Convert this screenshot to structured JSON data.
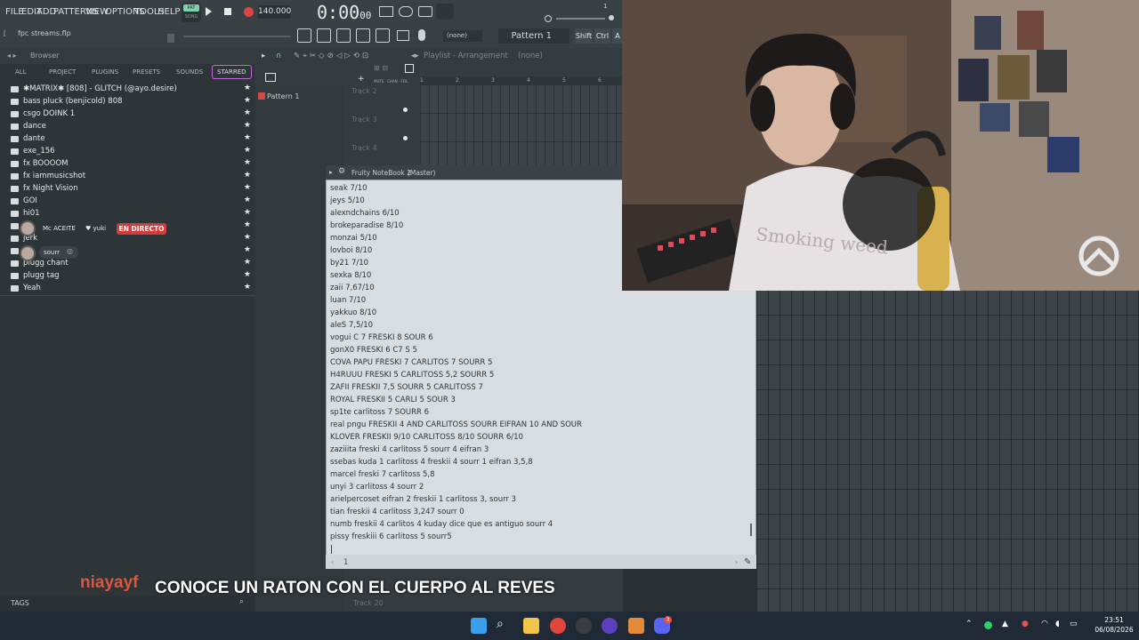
{
  "menubar": {
    "items": [
      "FILE",
      "EDIT",
      "ADD",
      "PATTERNS",
      "VIEW",
      "OPTIONS",
      "TOOLS",
      "HELP"
    ],
    "tempo": "140.000",
    "time": "0:00",
    "time_small": "00",
    "pat_label": "PAT",
    "song_label": "SONG"
  },
  "toolbar": {
    "project_file": "fpc streams.flp",
    "pattern_select": "Pattern 1",
    "none_select": "(none)",
    "shift_label": "Shift",
    "ctrl_label": "Ctrl",
    "alt_label": "A"
  },
  "browser": {
    "title": "Browser",
    "tabs": [
      "ALL",
      "PROJECT",
      "PLUGINS",
      "PRESETS",
      "SOUNDS",
      "STARRED"
    ],
    "items": [
      "✱MATRIX✱ [808] - GLITCH (@ayo.desire)",
      "bass pluck (benjicold) 808",
      "csgo DOINK 1",
      "dance",
      "dante",
      "exe_156",
      "fx BOOOOM",
      "fx iammusicshot",
      "fx Night Vision",
      "GOI",
      "hi01",
      "",
      "jerk",
      "",
      "plugg chant",
      "plugg tag",
      "Yeah"
    ],
    "tags_label": "TAGS"
  },
  "chat_overlay": {
    "user1": "Mc ACEITE",
    "user2": "yuki",
    "live": "EN DIRECTO",
    "user3": "sourr"
  },
  "playlist": {
    "title": "Playlist - Arrangement",
    "title_select": "(none)",
    "pattern": "Pattern 1",
    "tracks": [
      "Track 2",
      "Track 3",
      "Track 4"
    ],
    "bottom_track": "Track 20",
    "ruler": [
      "1",
      "2",
      "3",
      "4",
      "5",
      "6"
    ]
  },
  "notebook": {
    "title": "Fruity NoteBook 2",
    "title_target": "(Master)",
    "page": "1",
    "lines": [
      "seak 7/10",
      "jeys 5/10",
      "alexndchains 6/10",
      "brokeparadise 8/10",
      "monzai 5/10",
      "lovboi 8/10",
      "by21 7/10",
      "sexka 8/10",
      "zaii 7,67/10",
      "luan 7/10",
      "yakkuo 8/10",
      "aleS 7,5/10",
      "vogui C 7 FRESKI 8 SOUR 6",
      "gonX0 FRESKI 6 C7 S 5",
      "COVA PAPU FRESKI 7 CARLITOS 7 SOURR 5",
      "H4RUUU FRESKI 5 CARLITOSS 5,2 SOURR 5",
      "ZAFII FRESKII 7,5 SOURR 5 CARLITOSS 7",
      "ROYAL FRESKII 5 CARLI 5 SOUR 3",
      "sp1te carlitoss 7 SOURR 6",
      "real pngu FRESKII 4 AND CARLITOSS SOURR EIFRAN 10 AND SOUR",
      "KLOVER FRESKII 9/10 CARLITOSS 8/10 SOURR 6/10",
      "zaziiita freski 4 carlitoss 5 sourr 4 eifran 3",
      "ssebas kuda 1 carlitoss 4 freskii 4 sourr 1 eifran 3,5,8",
      "marcel freski 7 carlitoss 5,8",
      "unyi 3 carlitoss 4 sourr 2",
      "arielpercoset eifran 2 freskii 1 carlitoss 3, sourr 3",
      "tian freskii 4 carlitoss 3,247 sourr 0",
      "numb freskii 4 carlitos 4 kuday dice que es antiguo sourr 4",
      "pissy freskiii 6 carlitoss 5 sourr5"
    ]
  },
  "caption": {
    "user": "niayayf",
    "text": "CONOCE UN RATON CON EL CUERPO AL REVES"
  },
  "taskbar": {
    "time": "23:51",
    "date": "06/08/2026",
    "badge": "3"
  },
  "webcam": {
    "shirt_text": "Smoking weed"
  }
}
